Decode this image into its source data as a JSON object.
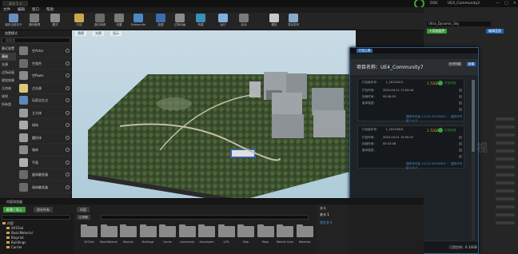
{
  "window": {
    "tab_title": "关卡 1 ×",
    "ddc_label": "DDC",
    "project_name": "UE4_Community2",
    "controls": [
      "—",
      "□",
      "✕"
    ]
  },
  "menu": [
    "文件",
    "编辑",
    "窗口",
    "帮助"
  ],
  "toolbar": [
    {
      "label": "保存当前关卡",
      "color": "#6b8fbf"
    },
    {
      "label": "源码管理",
      "color": "#7a7a7a"
    },
    {
      "label": "模式",
      "color": "#8a8a8a"
    },
    {
      "label": "内容",
      "color": "#c8a84a"
    },
    {
      "label": "虚幻商城",
      "color": "#6a6a6a"
    },
    {
      "label": "设置",
      "color": "#7a7a7a"
    },
    {
      "label": "Datasmith",
      "color": "#4a88c8"
    },
    {
      "label": "蓝图",
      "color": "#3b6cb0"
    },
    {
      "label": "过场动画",
      "color": "#8a8a8a"
    },
    {
      "label": "构建",
      "color": "#3a8fb8"
    },
    {
      "label": "运行",
      "color": "#7fb0e0"
    },
    {
      "label": "启动",
      "color": "#7a7a7a"
    },
    {
      "label": "模型",
      "color": "#c8c8c8"
    },
    {
      "label": "项目发布",
      "color": "#8aa8c8"
    }
  ],
  "modes_panel": {
    "header": "放置模式",
    "search_placeholder": "搜索类",
    "categories": [
      "最近放置",
      "基础",
      "光源",
      "过场动画",
      "视觉效果",
      "几何体",
      "体积",
      "所有类"
    ],
    "items": [
      {
        "name": "空Actor",
        "color": "#7a7a7a"
      },
      {
        "name": "空角色",
        "color": "#6a6a6a"
      },
      {
        "name": "空Pawn",
        "color": "#8a8a8a"
      },
      {
        "name": "点光源",
        "color": "#d8c87a"
      },
      {
        "name": "玩家出生点",
        "color": "#5a8aba"
      },
      {
        "name": "立方体",
        "color": "#9a9a9a"
      },
      {
        "name": "球体",
        "color": "#aaaaaa"
      },
      {
        "name": "圆柱体",
        "color": "#9a9a9a"
      },
      {
        "name": "锥体",
        "color": "#8a8a8a"
      },
      {
        "name": "平面",
        "color": "#b0b0b0"
      },
      {
        "name": "盒体触发器",
        "color": "#6a6a6a"
      },
      {
        "name": "球体触发器",
        "color": "#6a6a6a"
      }
    ]
  },
  "viewport": {
    "labels": [
      "透视",
      "光照",
      "显示"
    ]
  },
  "right_panel": {
    "search_text": "Ultra_Dynamic_Sky",
    "edit_button": "编辑蓝图",
    "add_button": "+添加组件"
  },
  "popup": {
    "top_button": "打包工具",
    "project_title": "项目名称：UE4_Community7",
    "btn_history": "历史构建",
    "btn_new": "新建",
    "cards": [
      {
        "version_label": "打包版本号：",
        "version": "1_20220411",
        "size": "1.72GB",
        "status": "打包完成",
        "time_label": "打包时间：",
        "time": "2022-04-11 17:04:44",
        "duration_label": "持续时间：",
        "duration": "00:18:29",
        "note_label": "版本描述：",
        "note": "",
        "license_text": "插件许可证 1.0.22.20220411 ｜ 插件许可证 1.4.2"
      },
      {
        "version_label": "打包版本号：",
        "version": "1_20220401",
        "size": "1.72GB",
        "status": "打包完成",
        "time_label": "打包时间：",
        "time": "2022-04-01 15:09:47",
        "duration_label": "持续时间：",
        "duration": "00:22:08",
        "note_label": "版本描述：",
        "note": "",
        "license_text": "插件许可证 1.0.22.20220401 ｜ 插件许可证 1.4.2"
      }
    ],
    "footer_left": "最大保存版本：20",
    "footer_right": "已用空间：6.14GB"
  },
  "content_browser": {
    "tab": "内容浏览器",
    "add_new": "新增 / 导入",
    "save_all": "保存所有",
    "path": "内容",
    "filter": "过滤器",
    "tree_root": "内容",
    "tree": [
      "001Tool",
      "BasicMaterial",
      "Bluprint",
      "Buildings",
      "Carrier"
    ],
    "folders": [
      "001Tool",
      "BasicMaterial",
      "Bluprint",
      "Buildings",
      "Carrier",
      "Community",
      "Developers",
      "LUTs",
      "Map",
      "Maps",
      "Materia Lines",
      "Materials"
    ],
    "right_labels": [
      "关卡",
      "关卡 1",
      "锁定关卡"
    ]
  },
  "watermark": "视"
}
